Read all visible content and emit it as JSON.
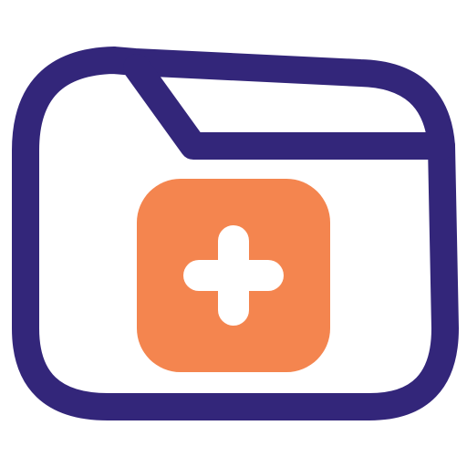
{
  "icon": {
    "name": "medical-folder-add",
    "colors": {
      "outline": "#33267A",
      "badge": "#F4854F",
      "plus": "#FFFFFF",
      "background": "#FFFFFF"
    }
  }
}
